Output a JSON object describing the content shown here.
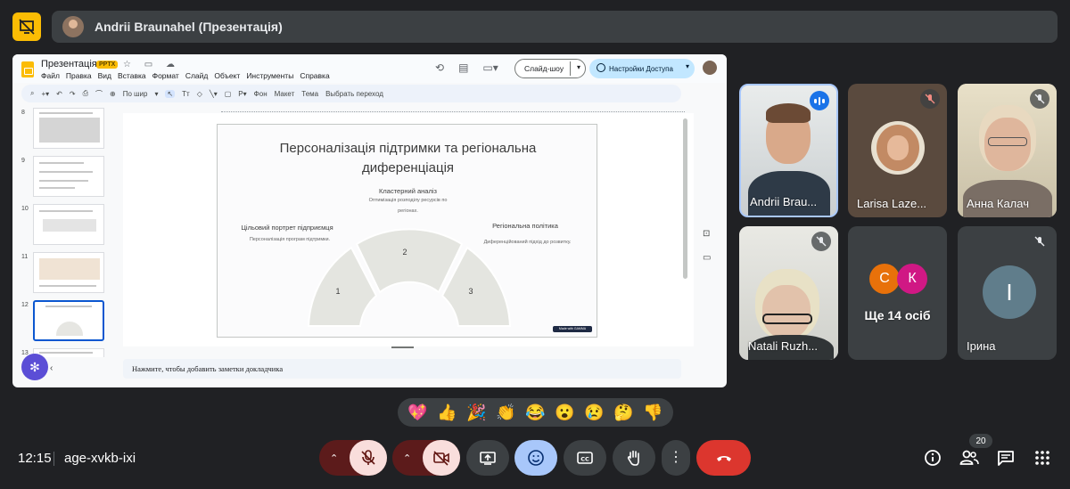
{
  "header": {
    "title": "Andrii Braunahel (Презентація)"
  },
  "shared_screen": {
    "doc_title": "Презентація",
    "badge": "PPTX",
    "menu": [
      "Файл",
      "Правка",
      "Вид",
      "Вставка",
      "Формат",
      "Слайд",
      "Объект",
      "Инструменты",
      "Справка"
    ],
    "slideshow_label": "Слайд-шоу",
    "share_label": "Настройки Доступа",
    "toolbar": {
      "zoom": "По шир",
      "background": "Фон",
      "layout": "Макет",
      "theme": "Тема",
      "transition": "Выбрать переход"
    },
    "thumbnails": [
      {
        "num": "8"
      },
      {
        "num": "9"
      },
      {
        "num": "10"
      },
      {
        "num": "11"
      },
      {
        "num": "12"
      },
      {
        "num": "13"
      }
    ],
    "slide": {
      "title_line1": "Персоналізація підтримки та регіональна",
      "title_line2": "диференціація",
      "cluster_label": "Кластерний аналіз",
      "cluster_sub1": "Оптимізація розподілу ресурсів по",
      "cluster_sub2": "регіонах.",
      "target_label": "Цільовий портрет підприємця",
      "target_sub": "Персоналізація програм підтримки.",
      "regional_label": "Регіональна політика",
      "regional_sub": "Диференційований підхід до розвитку.",
      "seg1": "1",
      "seg2": "2",
      "seg3": "3",
      "made_with": "Made with GAMMA"
    },
    "notes_placeholder": "Нажмите, чтобы добавить заметки докладчика"
  },
  "participants": [
    {
      "name": "Andrii Brau...",
      "state": "speaking"
    },
    {
      "name": "Larisa Laze...",
      "state": "muted"
    },
    {
      "name": "Анна Калач",
      "state": "muted"
    },
    {
      "name": "Natali Ruzh...",
      "state": "muted"
    },
    {
      "name": "Ще 14 осіб",
      "initials": [
        "С",
        "К"
      ]
    },
    {
      "name": "Ірина",
      "initial": "І",
      "state": "muted"
    }
  ],
  "reactions": [
    "💖",
    "👍",
    "🎉",
    "👏",
    "😂",
    "😮",
    "😢",
    "🤔",
    "👎"
  ],
  "footer": {
    "time": "12:15",
    "meeting_code": "age-xvkb-ixi",
    "participant_count": "20"
  },
  "colors": {
    "background": "#202124",
    "accent_yellow": "#fbbc04",
    "end_call_red": "#dc362e",
    "active_blue": "#a8c7fa",
    "muted_red": "#f9dedc"
  }
}
